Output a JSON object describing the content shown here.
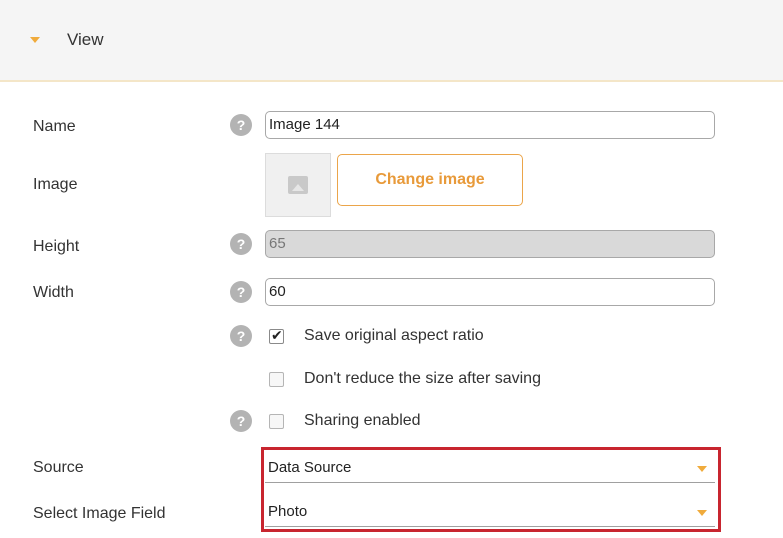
{
  "section": {
    "title": "View"
  },
  "fields": {
    "name": {
      "label": "Name",
      "value": "Image 144"
    },
    "image": {
      "label": "Image",
      "button": "Change image"
    },
    "height": {
      "label": "Height",
      "value": "65"
    },
    "width": {
      "label": "Width",
      "value": "60"
    }
  },
  "options": {
    "aspect_ratio": {
      "label": "Save original aspect ratio",
      "checked": true
    },
    "no_reduce": {
      "label": "Don't reduce the size after saving",
      "checked": false
    },
    "sharing": {
      "label": "Sharing enabled",
      "checked": false
    }
  },
  "source": {
    "label": "Source",
    "value": "Data Source"
  },
  "image_field": {
    "label": "Select Image Field",
    "value": "Photo"
  },
  "colors": {
    "accent": "#f0ab3c",
    "highlight": "#c8252f"
  },
  "icons": {
    "help": "?"
  }
}
